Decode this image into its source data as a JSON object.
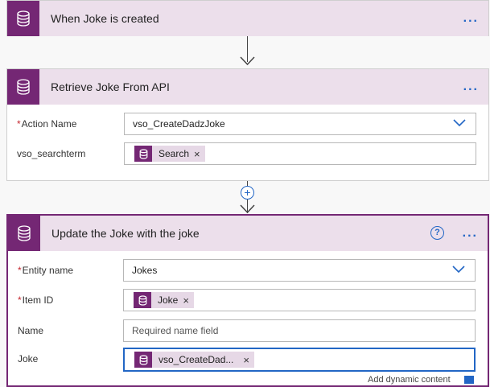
{
  "colors": {
    "accent": "#742774",
    "header_bg": "#ecdfeb",
    "link": "#2266c5",
    "required": "#c4262e"
  },
  "cards": [
    {
      "title": "When Joke is created",
      "icon": "database-icon",
      "more": "..."
    },
    {
      "title": "Retrieve Joke From API",
      "icon": "database-icon",
      "more": "...",
      "fields": [
        {
          "label": "Action Name",
          "required": true,
          "value": "vso_CreateDadzJoke",
          "type": "dropdown"
        },
        {
          "label": "vso_searchterm",
          "required": false,
          "token": "Search",
          "type": "token"
        }
      ]
    },
    {
      "title": "Update the Joke with the joke",
      "icon": "database-icon",
      "more": "...",
      "help": "?",
      "fields": [
        {
          "label": "Entity name",
          "required": true,
          "value": "Jokes",
          "type": "dropdown"
        },
        {
          "label": "Item ID",
          "required": true,
          "token": "Joke",
          "type": "token"
        },
        {
          "label": "Name",
          "required": false,
          "placeholder": "Required name field",
          "type": "text"
        },
        {
          "label": "Joke",
          "required": false,
          "token": "vso_CreateDad...",
          "type": "token"
        }
      ]
    }
  ],
  "required_mark": "*",
  "token_remove": "×",
  "add_step": "+",
  "footer_link": "Add dynamic content"
}
